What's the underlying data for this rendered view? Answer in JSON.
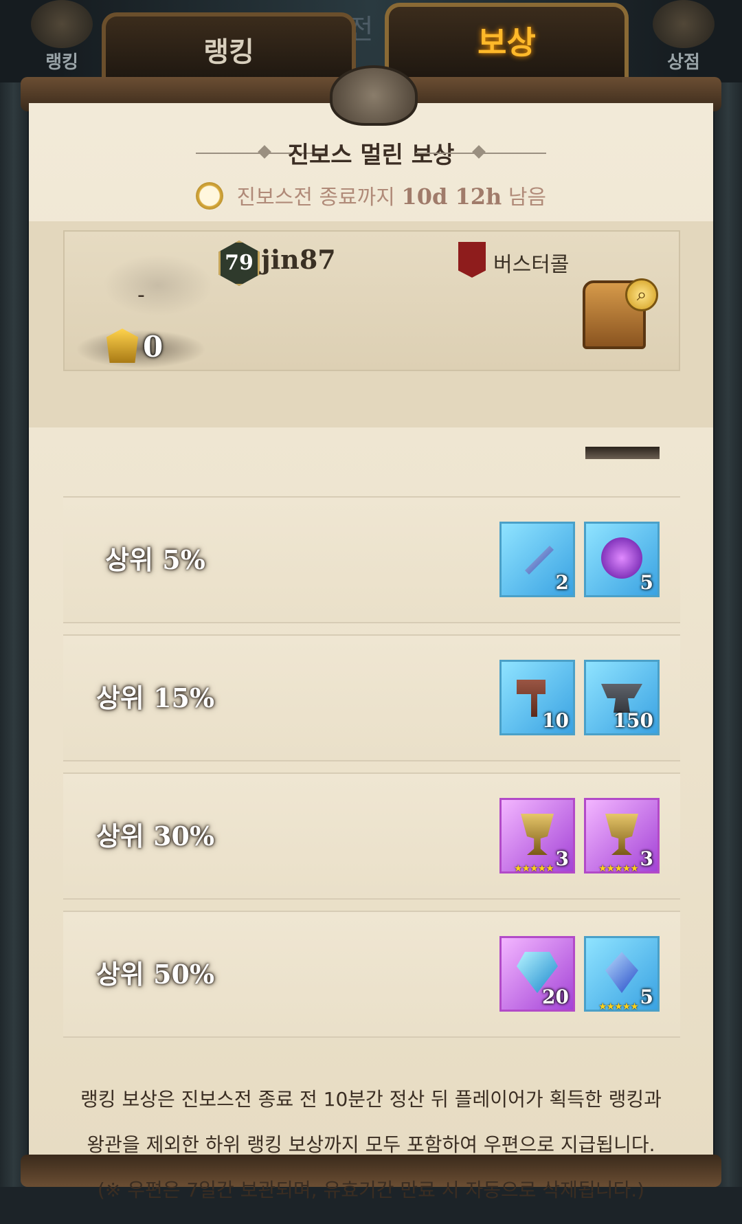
{
  "top_nav": {
    "left_icon_label": "랭킹",
    "right_icon_label": "상점",
    "ghost_text": "상전",
    "tabs": [
      {
        "label": "랭킹",
        "active": false
      },
      {
        "label": "보상",
        "active": true
      }
    ]
  },
  "header": {
    "title": "진보스 멀린 보상",
    "timer_prefix": "진보스전 종료까지",
    "timer_value": "10d 12h",
    "timer_suffix": "남음"
  },
  "player": {
    "rank": "-",
    "crown_count": "0",
    "level": "79",
    "name": "jin87",
    "guild": "버스터콜"
  },
  "rewards": [
    {
      "label": "상위 5%",
      "items": [
        {
          "name": "sword-icon",
          "qty": "2",
          "style": "blue"
        },
        {
          "name": "purple-gem-icon",
          "qty": "5",
          "style": "blue"
        }
      ]
    },
    {
      "label": "상위 15%",
      "items": [
        {
          "name": "hammer-icon",
          "qty": "10",
          "style": "blue"
        },
        {
          "name": "anvil-icon",
          "qty": "150",
          "style": "blue"
        }
      ]
    },
    {
      "label": "상위 30%",
      "items": [
        {
          "name": "gold-trophy-icon",
          "qty": "3",
          "style": "purple"
        },
        {
          "name": "purple-trophy-icon",
          "qty": "3",
          "style": "purple"
        }
      ]
    },
    {
      "label": "상위 50%",
      "items": [
        {
          "name": "diamond-icon",
          "qty": "20",
          "style": "purple"
        },
        {
          "name": "crystal-icon",
          "qty": "5",
          "style": "blue"
        }
      ]
    }
  ],
  "footer": {
    "line1": "랭킹 보상은 진보스전 종료 전 10분간 정산 뒤 플레이어가 획득한 랭킹과",
    "line2": "왕관을 제외한 하위 랭킹 보상까지 모두 포함하여 우편으로 지급됩니다.",
    "line3": "(※ 우편은 7일간 보관되며, 유효기간 만료 시 자동으로 삭제됩니다.)"
  },
  "colors": {
    "accent_tab": "#ffb92a",
    "paper": "#efe6d2",
    "text_dark": "#3c2e24",
    "timer_text": "#b08a78"
  }
}
